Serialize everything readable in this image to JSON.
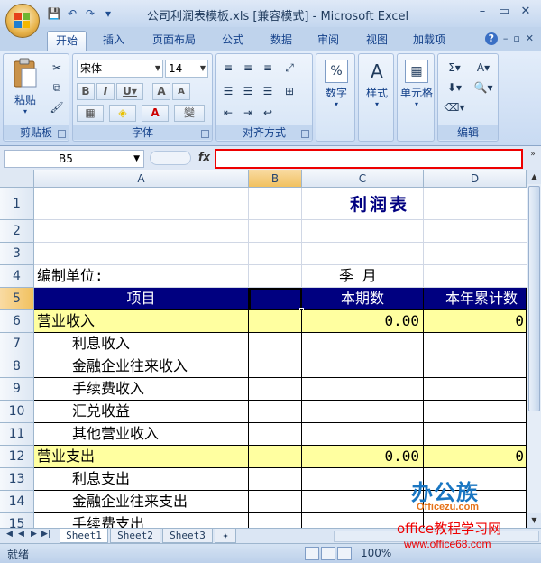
{
  "window": {
    "title": "公司利润表模板.xls  [兼容模式] - Microsoft Excel",
    "min": "–",
    "restore": "▭",
    "close": "✕"
  },
  "qat": {
    "save": "💾",
    "undo": "↶",
    "redo": "↷",
    "more": "▾"
  },
  "tabs": [
    "开始",
    "插入",
    "页面布局",
    "公式",
    "数据",
    "审阅",
    "视图",
    "加载项"
  ],
  "tabs_right": {
    "help": "?",
    "min": "–",
    "restore": "▫",
    "close": "✕"
  },
  "ribbon": {
    "clipboard": {
      "label": "剪贴板",
      "paste": "粘贴"
    },
    "font": {
      "label": "字体",
      "name": "宋体",
      "size": "14"
    },
    "alignment": {
      "label": "对齐方式"
    },
    "number": {
      "label": "数字",
      "icon_text": "%"
    },
    "styles": {
      "label": "样式"
    },
    "cells": {
      "label": "单元格"
    },
    "editing": {
      "label": "编辑"
    }
  },
  "formula_bar": {
    "name_box": "B5",
    "fx": "fx",
    "value": ""
  },
  "columns": [
    "A",
    "B",
    "C",
    "D"
  ],
  "rows": [
    "1",
    "2",
    "3",
    "4",
    "5",
    "6",
    "7",
    "8",
    "9",
    "10",
    "11",
    "12",
    "13",
    "14",
    "15"
  ],
  "sheet": {
    "title": "利润表",
    "unit_label": "编制单位:",
    "period_label": "季    月",
    "headers": {
      "item": "项目",
      "current": "本期数",
      "ytd": "本年累计数"
    },
    "income": {
      "label": "营业收入",
      "current": "0.00",
      "ytd": "0"
    },
    "income_items": [
      "利息收入",
      "金融企业往来收入",
      "手续费收入",
      "汇兑收益",
      "其他营业收入"
    ],
    "expense": {
      "label": "营业支出",
      "current": "0.00",
      "ytd": "0"
    },
    "expense_items": [
      "利息支出",
      "金融企业往来支出",
      "手续费支出"
    ]
  },
  "sheet_tabs": [
    "Sheet1",
    "Sheet2",
    "Sheet3"
  ],
  "status": {
    "ready": "就绪",
    "zoom": "100%"
  },
  "watermark": {
    "brand": "办公族",
    "brand_url": "Officezu.com",
    "site_name": "office教程学习网",
    "site_url": "www.office68.com"
  }
}
